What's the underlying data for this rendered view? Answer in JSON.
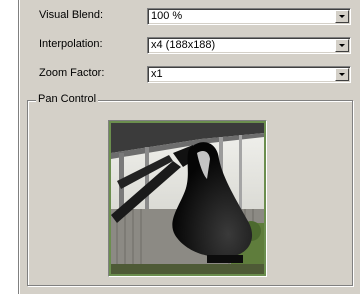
{
  "settings": {
    "visual_blend": {
      "label": "Visual Blend:",
      "value": "100 %"
    },
    "interpolation": {
      "label": "Interpolation:",
      "value": "x4 (188x188)"
    },
    "zoom_factor": {
      "label": "Zoom Factor:",
      "value": "x1"
    }
  },
  "pan_control": {
    "title": "Pan Control"
  },
  "colors": {
    "panel": "#d4d0c8",
    "preview_border": "#6b8e4e"
  }
}
